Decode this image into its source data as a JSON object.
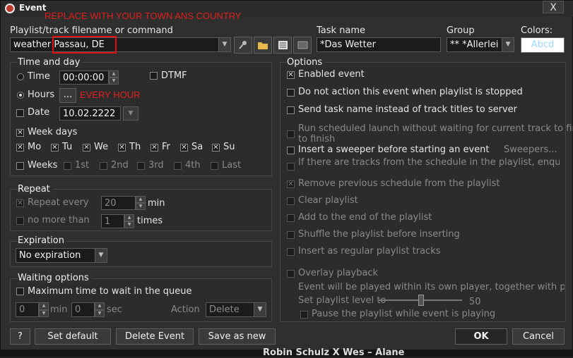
{
  "window": {
    "title": "Event",
    "close_glyph": "X"
  },
  "annotations": {
    "top_note": "REPLACE WITH YOUR TOWN ANS COUNTRY",
    "hours_note": "EVERY HOUR"
  },
  "playlist": {
    "label": "Playlist/track filename or command",
    "value": "weather Passau, DE"
  },
  "task": {
    "label": "Task name",
    "value": "*Das Wetter"
  },
  "group": {
    "label": "Group",
    "value": "** *Allerlei"
  },
  "colors": {
    "label": "Colors:",
    "sample": "Abcd",
    "bg": "#ffffff",
    "fg": "#9fd8ff"
  },
  "time_and_day": {
    "title": "Time and day",
    "time_label": "Time",
    "time_value": "00:00:00",
    "dtmf_label": "DTMF",
    "hours_label": "Hours",
    "hours_button": "...",
    "date_label": "Date",
    "date_value": "10.02.2222",
    "week_days_label": "Week days",
    "days": [
      "Mo",
      "Tu",
      "We",
      "Th",
      "Fr",
      "Sa",
      "Su"
    ],
    "weeks_label": "Weeks",
    "weeks": [
      "1st",
      "2nd",
      "3rd",
      "4th",
      "Last"
    ]
  },
  "repeat": {
    "title": "Repeat",
    "every_label": "Repeat every",
    "every_value": "20",
    "every_unit": "min",
    "nomore_label": "no more than",
    "nomore_value": "1",
    "nomore_unit": "times"
  },
  "expiration": {
    "title": "Expiration",
    "value": "No expiration"
  },
  "waiting": {
    "title": "Waiting options",
    "max_label": "Maximum time to wait in the queue",
    "min_value": "0",
    "min_unit": "min",
    "sec_value": "0",
    "sec_unit": "sec",
    "action_label": "Action",
    "action_value": "Delete"
  },
  "options": {
    "title": "Options",
    "items": [
      "Enabled event",
      "Do not action this event when playlist is stopped",
      "Send task name instead of track titles to server",
      "Run scheduled launch without waiting for current track to finish",
      "Insert a sweeper before starting an event",
      "If there are tracks from the schedule in the playlist, enqueue",
      "Remove previous schedule from the playlist",
      "Clear playlist",
      "Add to the end of the playlist",
      "Shuffle the playlist before inserting",
      "Insert as regular playlist tracks",
      "Overlay playback"
    ],
    "run_line2": "to finish",
    "sweepers_button": "Sweepers...",
    "overlay_note": "Event will be played within its own player, together with p",
    "level_label": "Set playlist level to",
    "level_value": "50",
    "pause_label": "Pause the playlist while event is playing"
  },
  "buttons": {
    "help": "?",
    "set_default": "Set default",
    "delete": "Delete Event",
    "save_new": "Save as new",
    "ok": "OK",
    "cancel": "Cancel"
  },
  "background_text": "Robin Schulz X Wes – Alane"
}
